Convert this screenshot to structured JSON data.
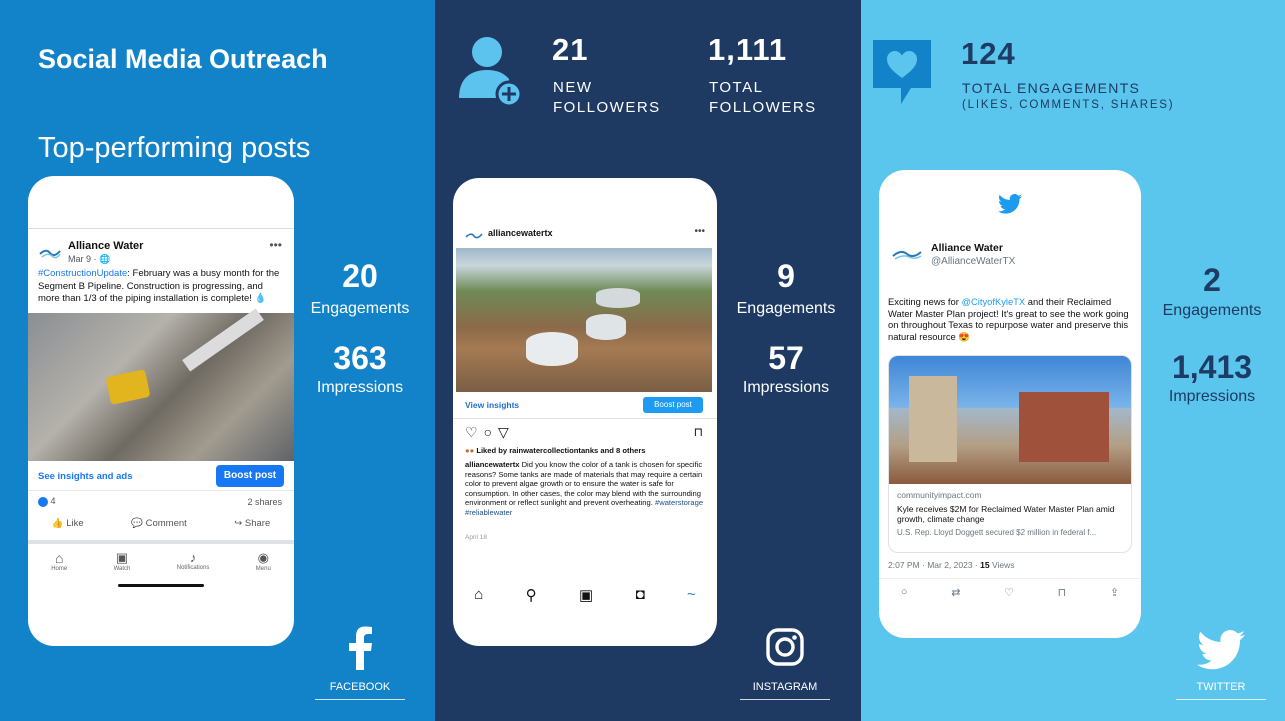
{
  "facebook": {
    "title": "Social Media Outreach",
    "subtitle": "Top-performing posts",
    "post": {
      "account": "Alliance Water",
      "date": "Mar 9 · 🌐",
      "hashtag": "#ConstructionUpdate",
      "text": ": February was a busy month for the Segment B Pipeline. Construction is progressing, and more than 1/3 of the piping installation is complete! 💧",
      "insights_link": "See insights and ads",
      "boost_label": "Boost post",
      "reactions": "4",
      "shares": "2 shares",
      "actions": [
        "Like",
        "Comment",
        "Share"
      ],
      "nav": [
        "Home",
        "Watch",
        "Notifications",
        "Menu"
      ]
    },
    "engagements_value": "20",
    "engagements_label": "Engagements",
    "impressions_value": "363",
    "impressions_label": "Impressions",
    "brand": "FACEBOOK",
    "colors": {
      "bg": "#1283c9",
      "accent": "#1877f2"
    }
  },
  "instagram": {
    "new_followers_value": "21",
    "new_followers_label_1": "NEW",
    "new_followers_label_2": "FOLLOWERS",
    "total_followers_value": "1,111",
    "total_followers_label_1": "TOTAL",
    "total_followers_label_2": "FOLLOWERS",
    "post": {
      "account": "alliancewatertx",
      "view_insights": "View insights",
      "boost_label": "Boost post",
      "liked_by": "Liked by rainwatercollectiontanks and 8 others",
      "caption_user": "alliancewatertx",
      "caption": " Did you know the color of a tank is chosen for specific reasons? Some tanks are made of materials that may require a certain color to prevent algae growth or to ensure the water is safe for consumption. In other cases, the color may blend with the surrounding environment or reflect sunlight and prevent overheating.",
      "hashtags": "#waterstorage #reliablewater",
      "date": "April 18"
    },
    "engagements_value": "9",
    "engagements_label": "Engagements",
    "impressions_value": "57",
    "impressions_label": "Impressions",
    "brand": "INSTAGRAM",
    "colors": {
      "bg": "#1e3a63"
    }
  },
  "twitter": {
    "total_engagements_value": "124",
    "total_engagements_label_1": "TOTAL ENGAGEMENTS",
    "total_engagements_label_2": "(LIKES, COMMENTS, SHARES)",
    "post": {
      "account": "Alliance Water",
      "handle": "@AllianceWaterTX",
      "text_1": "Exciting news for ",
      "mention": "@CityofKyleTX",
      "text_2": " and their Reclaimed Water Master Plan project! It's great to see the work going on throughout Texas to repurpose water and preserve this natural resource 😍",
      "card_domain": "communityimpact.com",
      "card_title": "Kyle receives $2M for Reclaimed Water Master Plan amid growth, climate change",
      "card_desc": "U.S. Rep. Lloyd Doggett secured $2 million in federal f...",
      "meta_time": "2:07 PM · Mar 2, 2023 · ",
      "views_count": "15",
      "views_label": " Views"
    },
    "engagements_value": "2",
    "engagements_label": "Engagements",
    "impressions_value": "1,413",
    "impressions_label": "Impressions",
    "brand": "TWITTER",
    "colors": {
      "bg": "#5ac6ee",
      "text": "#1d3b63",
      "accent": "#1d9bf0"
    }
  }
}
